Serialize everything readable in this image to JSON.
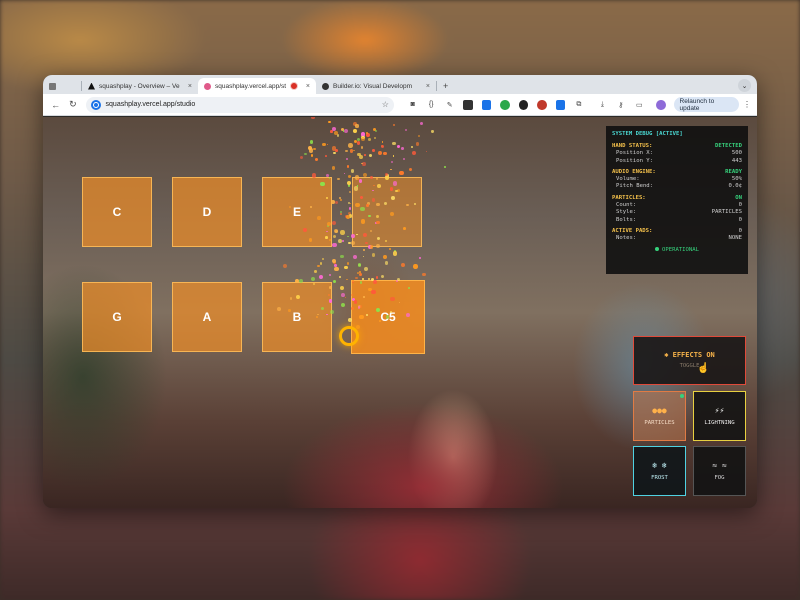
{
  "browser": {
    "tabs": [
      {
        "title": "",
        "favicon": "window-icon",
        "active": false
      },
      {
        "title": "squashplay - Overview – Ve",
        "favicon": "vercel-icon",
        "active": false
      },
      {
        "title": "squashplay.vercel.app/st",
        "favicon": "squashplay-icon",
        "active": true,
        "recording": true
      },
      {
        "title": "Builder.io: Visual Developm",
        "favicon": "builder-icon",
        "active": false
      }
    ],
    "close_glyph": "×",
    "new_tab_glyph": "+",
    "tab_menu_glyph": "⌄",
    "url": "squashplay.vercel.app/studio",
    "relaunch_label": "Relaunch to update",
    "menu_glyph": "⋮"
  },
  "pads": {
    "row1": [
      "C",
      "D",
      "E",
      ""
    ],
    "row2": [
      "G",
      "A",
      "B",
      "C5"
    ]
  },
  "debug": {
    "title": "SYSTEM DEBUG [ACTIVE]",
    "hand_status_label": "HAND STATUS:",
    "hand_status_value": "DETECTED",
    "position_x_label": "Position X:",
    "position_x_value": "500",
    "position_y_label": "Position Y:",
    "position_y_value": "443",
    "audio_label": "AUDIO ENGINE:",
    "audio_value": "READY",
    "volume_label": "Volume:",
    "volume_value": "50%",
    "pitch_label": "Pitch Bend:",
    "pitch_value": "0.0¢",
    "particles_label": "PARTICLES:",
    "particles_value": "ON",
    "count_label": "Count:",
    "count_value": "0",
    "style_label": "Style:",
    "style_value": "PARTICLES",
    "bolts_label": "Bolts:",
    "bolts_value": "0",
    "active_pads_label": "ACTIVE PADS:",
    "active_pads_value": "0",
    "notes_label": "Notes:",
    "notes_value": "NONE",
    "status": "OPERATIONAL"
  },
  "effects": {
    "toggle_label": "✱ EFFECTS ON",
    "toggle_hint": "TOGGLE",
    "particles": {
      "icon": "●●●",
      "label": "PARTICLES"
    },
    "lightning": {
      "icon": "⚡⚡",
      "label": "LIGHTNING"
    },
    "frost": {
      "icon": "❄ ❄",
      "label": "FROST"
    },
    "fog": {
      "icon": "≈ ≈",
      "label": "FOG"
    }
  },
  "colors": {
    "pad": "#eb8c28",
    "debug_title": "#4ad6d0",
    "debug_section": "#f3c04b",
    "debug_ok": "#36d27c",
    "toggle_border": "#e04a3a",
    "frost_border": "#4fd2e2",
    "lightning_border": "#e8d040"
  }
}
